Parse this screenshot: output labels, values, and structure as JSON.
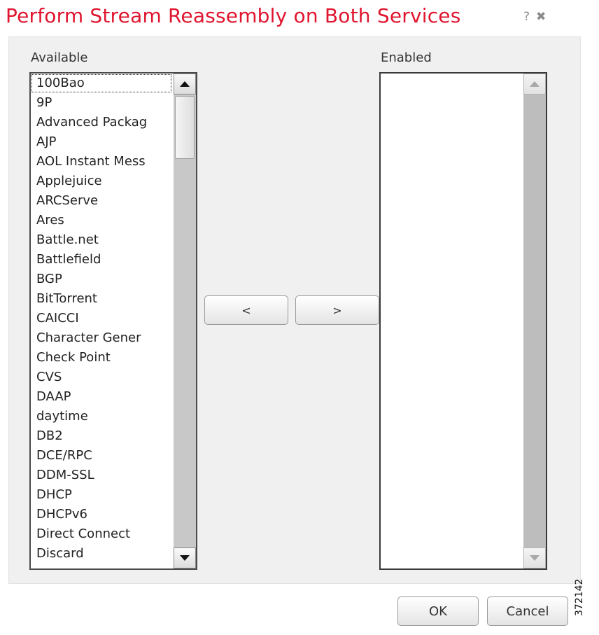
{
  "dialog": {
    "title": "Perform Stream Reassembly on Both Services",
    "help_icon": "?",
    "close_icon": "✖"
  },
  "available": {
    "label": "Available",
    "items": [
      "100Bao",
      "9P",
      "Advanced Packag",
      "AJP",
      "AOL Instant Mess",
      "Applejuice",
      "ARCServe",
      "Ares",
      "Battle.net",
      "Battlefield",
      "BGP",
      "BitTorrent",
      "CAICCI",
      "Character Gener",
      "Check Point",
      "CVS",
      "DAAP",
      "daytime",
      "DB2",
      "DCE/RPC",
      "DDM-SSL",
      "DHCP",
      "DHCPv6",
      "Direct Connect",
      "Discard"
    ]
  },
  "enabled": {
    "label": "Enabled",
    "items": []
  },
  "move_buttons": {
    "left_label": "<",
    "right_label": ">"
  },
  "footer": {
    "ok_label": "OK",
    "cancel_label": "Cancel"
  },
  "figure_id": "372142",
  "colors": {
    "title": "#e0152f",
    "panel_bg": "#f0f0f0"
  }
}
